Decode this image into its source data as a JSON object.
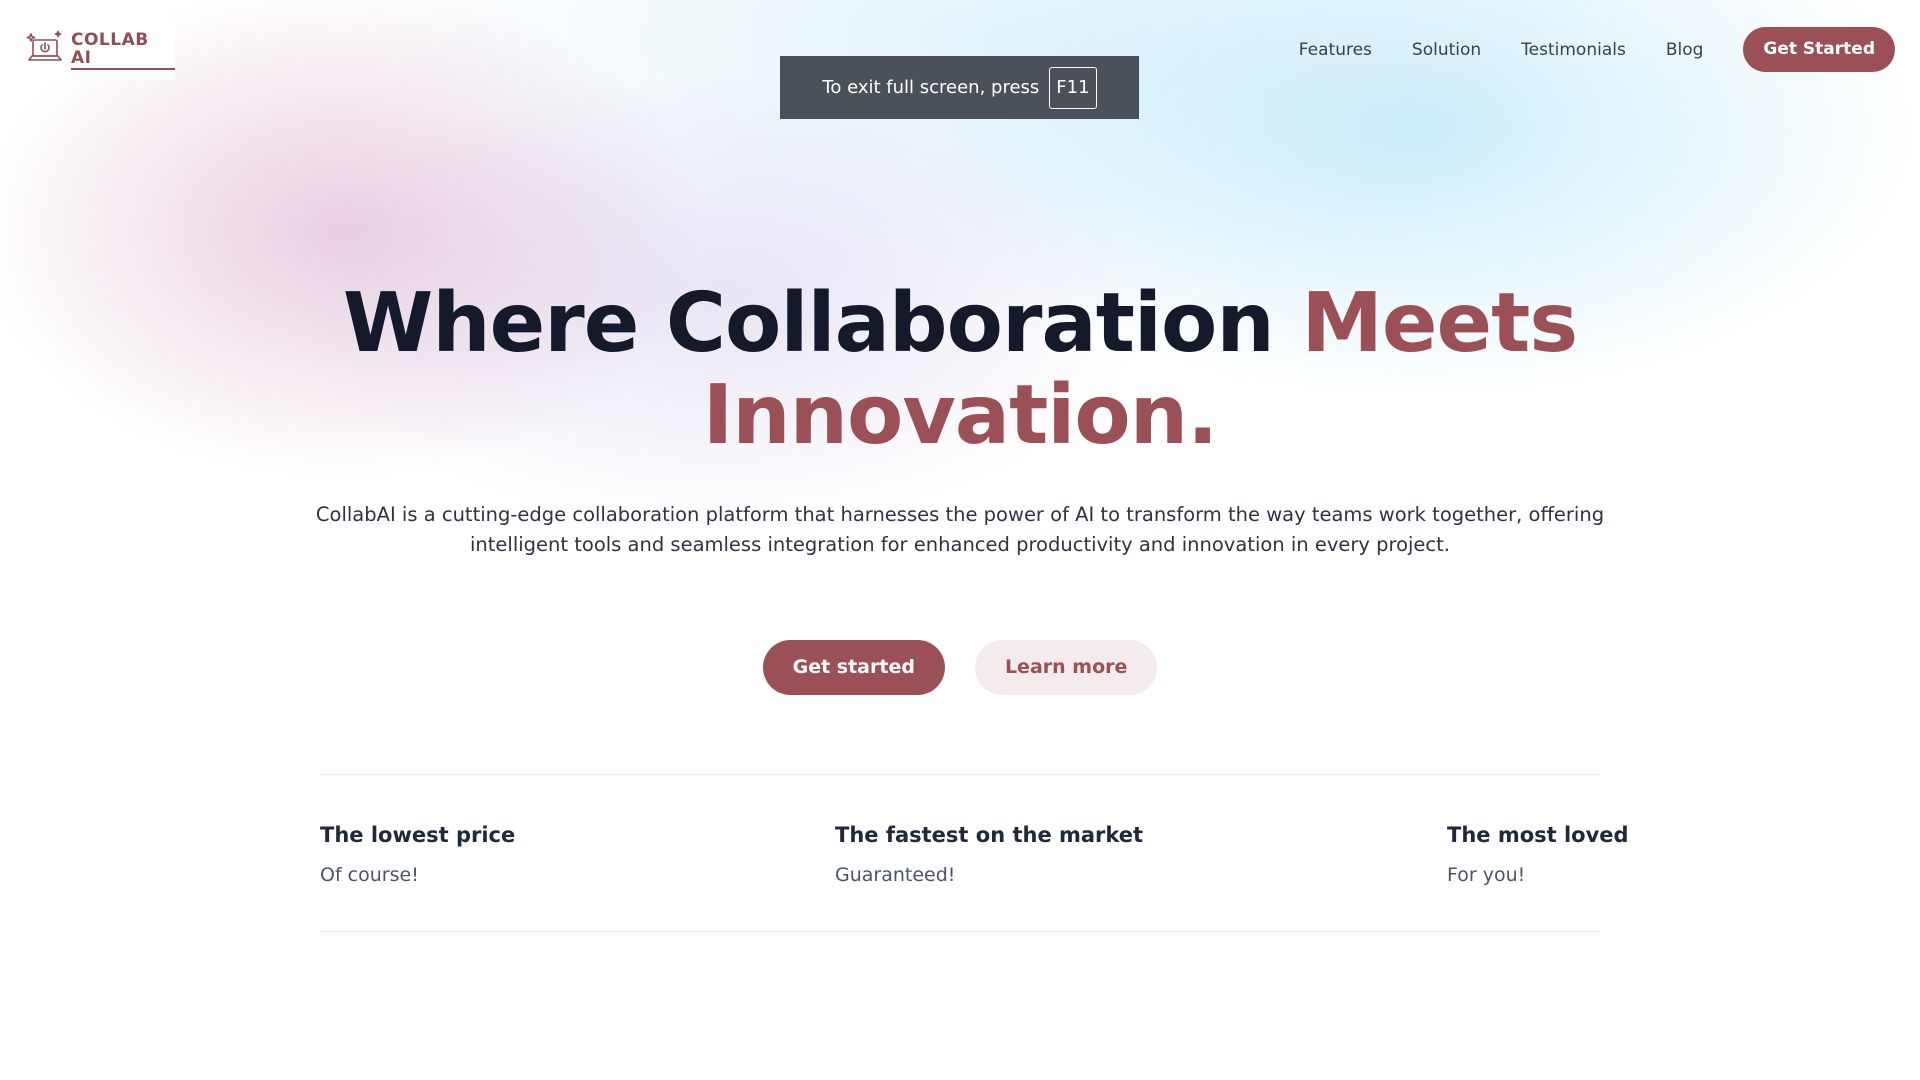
{
  "header": {
    "logo_text": "COLLAB AI",
    "nav": {
      "items": [
        "Features",
        "Solution",
        "Testimonials",
        "Blog"
      ],
      "cta_label": "Get Started"
    }
  },
  "fullscreen_notice": {
    "text": "To exit full screen, press",
    "key": "F11"
  },
  "hero": {
    "title_part1": "Where Collaboration",
    "title_accent": "Meets Innovation.",
    "title_accent_line1": "Meets",
    "title_accent_line2": "Innovation.",
    "subtitle": "CollabAI is a cutting-edge collaboration platform that harnesses the power of AI to transform the way teams work together, offering intelligent tools and seamless integration for enhanced productivity and innovation in every project.",
    "primary_button": "Get started",
    "secondary_button": "Learn more"
  },
  "features": [
    {
      "title": "The lowest price",
      "desc": "Of course!"
    },
    {
      "title": "The fastest on the market",
      "desc": "Guaranteed!"
    },
    {
      "title": "The most loved",
      "desc": "For you!"
    }
  ],
  "colors": {
    "accent": "#9b5055",
    "heading": "#141a2b",
    "toast_bg": "#4b5158"
  },
  "icons": {
    "logo": "laptop-sparkle-icon"
  }
}
